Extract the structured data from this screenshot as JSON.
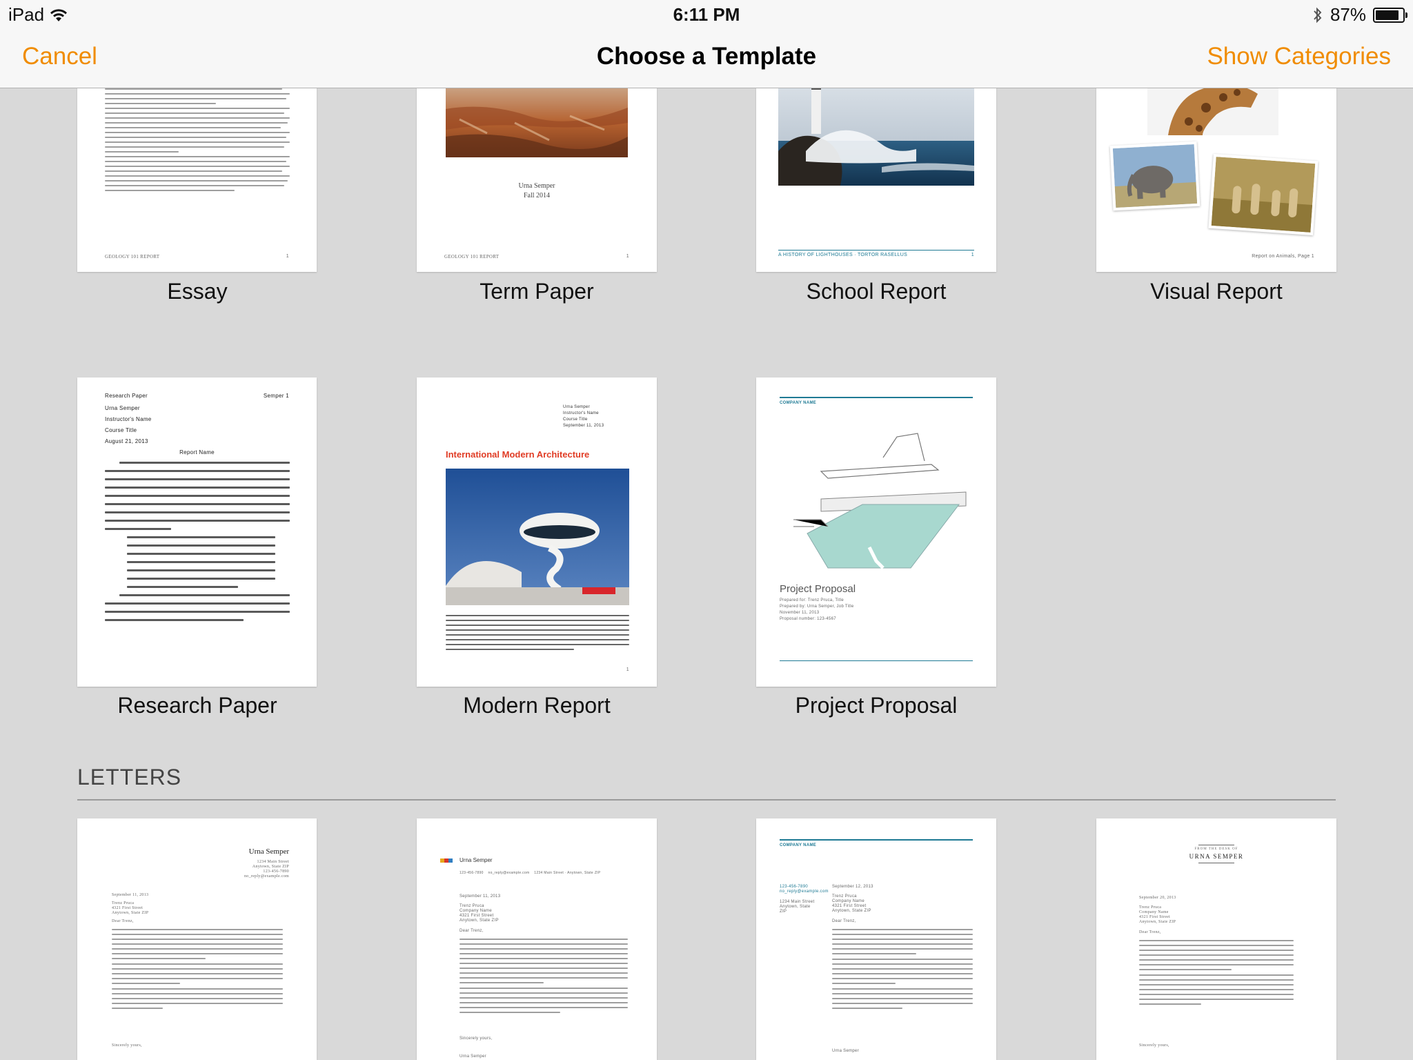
{
  "status": {
    "device": "iPad",
    "time": "6:11 PM",
    "battery_pct": "87%",
    "battery_level": 0.87
  },
  "nav": {
    "cancel": "Cancel",
    "title": "Choose a Template",
    "categories": "Show Categories"
  },
  "reports": [
    {
      "label": "Essay",
      "footer": "GEOLOGY 101 REPORT",
      "page_num": "1"
    },
    {
      "label": "Term Paper",
      "author": "Urna Semper",
      "term": "Fall 2014",
      "footer": "GEOLOGY 101 REPORT",
      "page_num": "1"
    },
    {
      "label": "School Report",
      "footer": "A HISTORY OF LIGHTHOUSES · TORTOR RASELLUS",
      "page_num": "1"
    },
    {
      "label": "Visual Report",
      "footer": "Report on Animals, Page 1"
    },
    {
      "label": "Research Paper",
      "head_left": "Research Paper",
      "head_right": "Semper 1",
      "lines": [
        "Urna Semper",
        "Instructor's Name",
        "Course Title",
        "August 21, 2013"
      ],
      "report_name": "Report Name"
    },
    {
      "label": "Modern Report",
      "meta": [
        "Urna Semper",
        "Instructor's Name",
        "Course Title",
        "September 11, 2013"
      ],
      "headline": "International Modern Architecture",
      "page_num": "1"
    },
    {
      "label": "Project Proposal",
      "company": "COMPANY NAME",
      "heading": "Project Proposal",
      "meta": [
        "Prepared for: Trenz Pruca, Title",
        "Prepared by: Urna Semper, Job Title",
        "November 11, 2013",
        "Proposal number: 123-4567"
      ]
    }
  ],
  "letters_section": "LETTERS",
  "letters": [
    {
      "name": "Urna Semper",
      "address": [
        "1234 Main Street",
        "Anytown, State ZIP",
        "123-456-7890",
        "no_reply@example.com"
      ],
      "date": "September 11, 2013",
      "to": [
        "Trenz Pruca",
        "4321 First Street",
        "Anytown, State ZIP"
      ],
      "greeting": "Dear Trenz,",
      "closing": "Sincerely yours,"
    },
    {
      "name": "Urna Semper",
      "contact": "123-456-7890    no_reply@example.com    1234 Main Street · Anytown, State ZIP",
      "date": "September 11, 2013",
      "to": [
        "Trenz Pruca",
        "Company Name",
        "4321 First Street",
        "Anytown, State ZIP"
      ],
      "greeting": "Dear Trenz,",
      "closing": "Sincerely yours,",
      "signature": "Urna Semper"
    },
    {
      "company": "COMPANY NAME",
      "side": [
        "123-456-7890",
        "no_reply@example.com",
        "",
        "1234 Main Street",
        "Anytown, State",
        "ZIP"
      ],
      "date": "September 12, 2013",
      "to": [
        "Trenz Pruca",
        "Company Name",
        "4321 First Street",
        "Anytown, State ZIP"
      ],
      "greeting": "Dear Trenz,",
      "signature": "Urna Semper"
    },
    {
      "desk": "FROM THE DESK OF",
      "name": "URNA SEMPER",
      "date": "September 20, 2013",
      "to": [
        "Trenz Pruca",
        "Company Name",
        "4321 First Street",
        "Anytown, State ZIP"
      ],
      "greeting": "Dear Trenz,",
      "closing": "Sincerely yours,"
    }
  ],
  "colors": {
    "accent": "#f08c00",
    "red_headline": "#e03b24",
    "teal": "#1e7a94"
  }
}
